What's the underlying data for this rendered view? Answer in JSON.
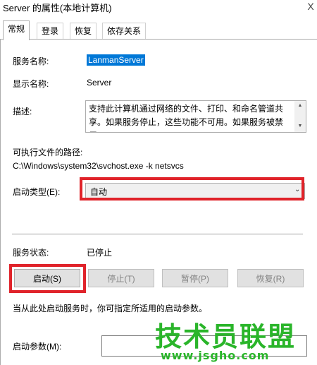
{
  "window": {
    "title": "Server 的属性(本地计算机)",
    "close_label": "X"
  },
  "tabs": [
    {
      "label": "常规",
      "active": true
    },
    {
      "label": "登录",
      "active": false
    },
    {
      "label": "恢复",
      "active": false
    },
    {
      "label": "依存关系",
      "active": false
    }
  ],
  "general": {
    "service_name_label": "服务名称:",
    "service_name": "LanmanServer",
    "display_name_label": "显示名称:",
    "display_name": "Server",
    "description_label": "描述:",
    "description": "支持此计算机通过网络的文件、打印、和命名管道共享。如果服务停止，这些功能不可用。如果服务被禁用，",
    "exe_path_label": "可执行文件的路径:",
    "exe_path": "C:\\Windows\\system32\\svchost.exe -k netsvcs",
    "startup_type_label": "启动类型(E):",
    "startup_type_value": "自动",
    "service_status_label": "服务状态:",
    "service_status": "已停止",
    "buttons": {
      "start": "启动(S)",
      "stop": "停止(T)",
      "pause": "暂停(P)",
      "resume": "恢复(R)"
    },
    "hint": "当从此处启动服务时，你可指定所适用的启动参数。",
    "start_params_label": "启动参数(M):",
    "start_params_value": ""
  },
  "watermark": {
    "name": "技术员联盟",
    "url": "www.jsgho.com"
  },
  "colors": {
    "highlight_border": "#e0232a",
    "selection": "#0078d7",
    "watermark": "#2ab52a"
  }
}
